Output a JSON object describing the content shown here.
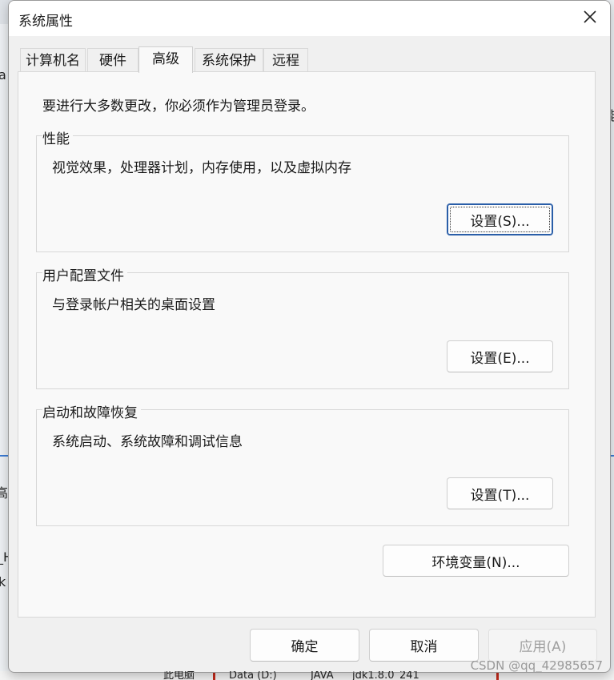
{
  "dialog": {
    "title": "系统属性",
    "close_glyph": "✕"
  },
  "tabs": [
    {
      "label": "计算机名",
      "active": false
    },
    {
      "label": "硬件",
      "active": false
    },
    {
      "label": "高级",
      "active": true
    },
    {
      "label": "系统保护",
      "active": false
    },
    {
      "label": "远程",
      "active": false
    }
  ],
  "panel": {
    "intro": "要进行大多数更改，你必须作为管理员登录。",
    "groups": [
      {
        "label": "性能",
        "description": "视觉效果，处理器计划，内存使用，以及虚拟内存",
        "button": "设置(S)..."
      },
      {
        "label": "用户配置文件",
        "description": "与登录帐户相关的桌面设置",
        "button": "设置(E)..."
      },
      {
        "label": "启动和故障恢复",
        "description": "系统启动、系统故障和调试信息",
        "button": "设置(T)..."
      }
    ],
    "env_button": "环境变量(N)..."
  },
  "footer": {
    "ok": "确定",
    "cancel": "取消",
    "apply": "应用(A)"
  },
  "background": {
    "fragments": [
      "a",
      "能",
      "高",
      "_H",
      "k",
      "此电脑",
      "Data (D:)",
      "JAVA",
      "jdk1.8.0_241"
    ]
  },
  "watermark": "CSDN @qq_42985657",
  "colors": {
    "focus_border": "#2a5ea8",
    "disabled_text": "#a0a0a0",
    "accent_red": "#c42b1c"
  }
}
